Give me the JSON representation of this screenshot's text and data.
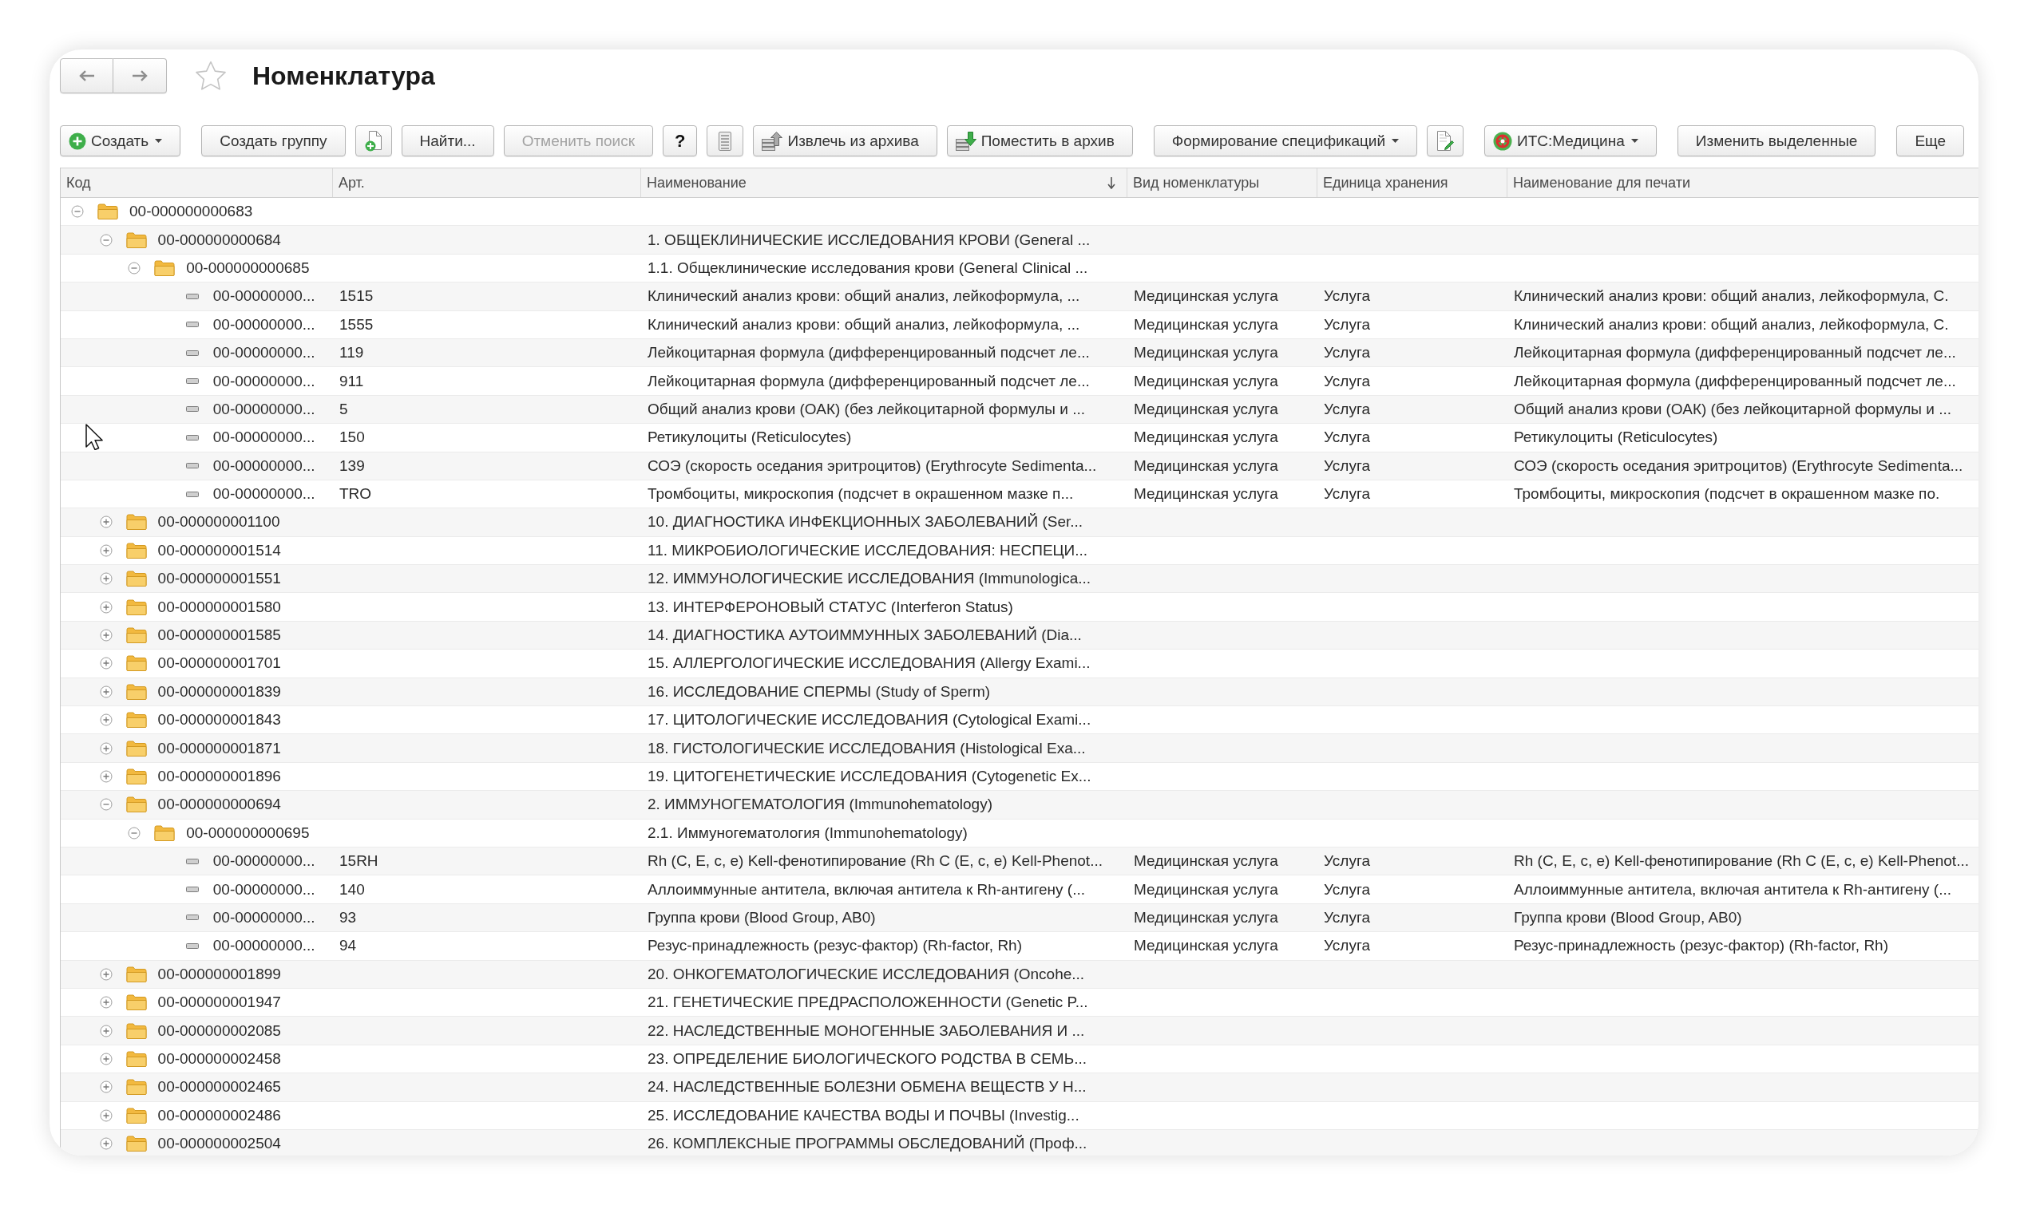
{
  "window": {
    "title": "Номенклатура"
  },
  "toolbar": {
    "groups": [
      {
        "buttons": [
          {
            "kind": "add",
            "label": "Создать",
            "dropdown": true,
            "disabled": false
          }
        ]
      },
      {
        "buttons": [
          {
            "kind": "plain",
            "label": "Создать группу",
            "dropdown": false,
            "disabled": false
          },
          {
            "kind": "addfile",
            "dropdown": false,
            "disabled": false
          },
          {
            "kind": "plain",
            "label": "Найти...",
            "dropdown": false,
            "disabled": false
          },
          {
            "kind": "plain",
            "label": "Отменить поиск",
            "dropdown": false,
            "disabled": true
          },
          {
            "kind": "help",
            "label": "?",
            "dropdown": false,
            "disabled": false
          },
          {
            "kind": "list",
            "dropdown": false,
            "disabled": false
          },
          {
            "kind": "unarchive",
            "label": "Извлечь из архива",
            "dropdown": false,
            "disabled": false
          },
          {
            "kind": "archive",
            "label": "Поместить в архив",
            "dropdown": false,
            "disabled": false
          }
        ]
      },
      {
        "buttons": [
          {
            "kind": "plain",
            "label": "Формирование спецификаций",
            "dropdown": true,
            "disabled": false
          },
          {
            "kind": "editdoc",
            "dropdown": false,
            "disabled": false
          }
        ]
      },
      {
        "buttons": [
          {
            "kind": "service",
            "label": "ИТС:Медицина",
            "dropdown": true,
            "disabled": false
          }
        ]
      },
      {
        "buttons": [
          {
            "kind": "plain",
            "label": "Изменить выделенные",
            "dropdown": false,
            "disabled": false
          }
        ]
      },
      {
        "buttons": [
          {
            "kind": "plain",
            "label": "Еще",
            "dropdown": false,
            "disabled": false
          }
        ]
      }
    ]
  },
  "table": {
    "columns": [
      {
        "label": "Код",
        "sorted": false
      },
      {
        "label": "Арт.",
        "sorted": false
      },
      {
        "label": "Наименование",
        "sorted": true
      },
      {
        "label": "Вид номенклатуры",
        "sorted": false
      },
      {
        "label": "Единица хранения",
        "sorted": false
      },
      {
        "label": "Наименование для печати",
        "sorted": false
      }
    ],
    "rows": [
      {
        "kind": "folder",
        "code": "00-000000000683",
        "expanded": true,
        "children": [
          {
            "kind": "folder",
            "code": "00-000000000684",
            "name": "1. ОБЩЕКЛИНИЧЕСКИЕ ИССЛЕДОВАНИЯ КРОВИ (General ...",
            "expanded": true,
            "children": [
              {
                "kind": "folder",
                "code": "00-000000000685",
                "name": "1.1. Общеклинические исследования крови (General Clinical ...",
                "expanded": true,
                "children": [
                  {
                    "kind": "item",
                    "code": "00-00000000...",
                    "article": "1515",
                    "name": "Клинический анализ крови: общий анализ, лейкоформула, ...",
                    "nomenclature_type": "Медицинская услуга",
                    "storage_unit": "Услуга",
                    "print_name": "Клинический анализ крови: общий анализ, лейкоформула, С."
                  },
                  {
                    "kind": "item",
                    "code": "00-00000000...",
                    "article": "1555",
                    "name": "Клинический анализ крови: общий анализ, лейкоформула, ...",
                    "nomenclature_type": "Медицинская услуга",
                    "storage_unit": "Услуга",
                    "print_name": "Клинический анализ крови: общий анализ, лейкоформула, С."
                  },
                  {
                    "kind": "item",
                    "code": "00-00000000...",
                    "article": "119",
                    "name": "Лейкоцитарная формула (дифференцированный подсчет ле...",
                    "nomenclature_type": "Медицинская услуга",
                    "storage_unit": "Услуга",
                    "print_name": "Лейкоцитарная формула (дифференцированный подсчет ле..."
                  },
                  {
                    "kind": "item",
                    "code": "00-00000000...",
                    "article": "911",
                    "name": "Лейкоцитарная формула (дифференцированный подсчет ле...",
                    "nomenclature_type": "Медицинская услуга",
                    "storage_unit": "Услуга",
                    "print_name": "Лейкоцитарная формула (дифференцированный подсчет ле..."
                  },
                  {
                    "kind": "item",
                    "code": "00-00000000...",
                    "article": "5",
                    "name": "Общий анализ крови (ОАК) (без лейкоцитарной формулы и ...",
                    "nomenclature_type": "Медицинская услуга",
                    "storage_unit": "Услуга",
                    "print_name": "Общий анализ крови (ОАК) (без лейкоцитарной формулы и ..."
                  },
                  {
                    "kind": "item",
                    "code": "00-00000000...",
                    "article": "150",
                    "name": "Ретикулоциты (Reticulocytes)",
                    "nomenclature_type": "Медицинская услуга",
                    "storage_unit": "Услуга",
                    "print_name": "Ретикулоциты (Reticulocytes)"
                  },
                  {
                    "kind": "item",
                    "code": "00-00000000...",
                    "article": "139",
                    "name": "СОЭ (скорость оседания эритроцитов) (Erythrocyte Sedimenta...",
                    "nomenclature_type": "Медицинская услуга",
                    "storage_unit": "Услуга",
                    "print_name": "СОЭ (скорость оседания эритроцитов) (Erythrocyte Sedimenta..."
                  },
                  {
                    "kind": "item",
                    "code": "00-00000000...",
                    "article": "TRO",
                    "name": "Тромбоциты, микроскопия (подсчет в окрашенном мазке п...",
                    "nomenclature_type": "Медицинская услуга",
                    "storage_unit": "Услуга",
                    "print_name": "Тромбоциты, микроскопия (подсчет в окрашенном мазке по."
                  }
                ]
              }
            ]
          },
          {
            "kind": "folder",
            "code": "00-000000001100",
            "name": "10. ДИАГНОСТИКА ИНФЕКЦИОННЫХ ЗАБОЛЕВАНИЙ (Ser...",
            "expanded": false
          },
          {
            "kind": "folder",
            "code": "00-000000001514",
            "name": "11. МИКРОБИОЛОГИЧЕСКИЕ ИССЛЕДОВАНИЯ: НЕСПЕЦИ...",
            "expanded": false
          },
          {
            "kind": "folder",
            "code": "00-000000001551",
            "name": "12. ИММУНОЛОГИЧЕСКИЕ ИССЛЕДОВАНИЯ (Immunologica...",
            "expanded": false
          },
          {
            "kind": "folder",
            "code": "00-000000001580",
            "name": "13. ИНТЕРФЕРОНОВЫЙ СТАТУС (Interferon Status)",
            "expanded": false
          },
          {
            "kind": "folder",
            "code": "00-000000001585",
            "name": "14. ДИАГНОСТИКА АУТОИММУННЫХ ЗАБОЛЕВАНИЙ (Dia...",
            "expanded": false
          },
          {
            "kind": "folder",
            "code": "00-000000001701",
            "name": "15. АЛЛЕРГОЛОГИЧЕСКИЕ ИССЛЕДОВАНИЯ (Allergy Exami...",
            "expanded": false
          },
          {
            "kind": "folder",
            "code": "00-000000001839",
            "name": "16. ИССЛЕДОВАНИЕ СПЕРМЫ (Study of Sperm)",
            "expanded": false
          },
          {
            "kind": "folder",
            "code": "00-000000001843",
            "name": "17. ЦИТОЛОГИЧЕСКИЕ ИССЛЕДОВАНИЯ (Cytological Exami...",
            "expanded": false
          },
          {
            "kind": "folder",
            "code": "00-000000001871",
            "name": "18. ГИСТОЛОГИЧЕСКИЕ ИССЛЕДОВАНИЯ (Histological Exa...",
            "expanded": false
          },
          {
            "kind": "folder",
            "code": "00-000000001896",
            "name": "19. ЦИТОГЕНЕТИЧЕСКИЕ ИССЛЕДОВАНИЯ (Cytogenetic Ex...",
            "expanded": false
          },
          {
            "kind": "folder",
            "code": "00-000000000694",
            "name": "2. ИММУНОГЕМАТОЛОГИЯ (Immunohematology)",
            "expanded": true,
            "children": [
              {
                "kind": "folder",
                "code": "00-000000000695",
                "name": "2.1. Иммуногематология (Immunohematology)",
                "expanded": true,
                "children": [
                  {
                    "kind": "item",
                    "code": "00-00000000...",
                    "article": "15RH",
                    "name": "Rh (C, E, c, e) Kell-фенотипирование (Rh C (E, c, e) Kell-Phenot...",
                    "nomenclature_type": "Медицинская услуга",
                    "storage_unit": "Услуга",
                    "print_name": "Rh (C, E, c, e) Kell-фенотипирование (Rh C (E, c, e) Kell-Phenot..."
                  },
                  {
                    "kind": "item",
                    "code": "00-00000000...",
                    "article": "140",
                    "name": "Аллоиммунные антитела, включая антитела к Rh-антигену (...",
                    "nomenclature_type": "Медицинская услуга",
                    "storage_unit": "Услуга",
                    "print_name": "Аллоиммунные антитела, включая антитела к Rh-антигену (..."
                  },
                  {
                    "kind": "item",
                    "code": "00-00000000...",
                    "article": "93",
                    "name": "Группа крови (Blood Group, AB0)",
                    "nomenclature_type": "Медицинская услуга",
                    "storage_unit": "Услуга",
                    "print_name": "Группа крови (Blood Group, AB0)"
                  },
                  {
                    "kind": "item",
                    "code": "00-00000000...",
                    "article": "94",
                    "name": "Резус-принадлежность (резус-фактор) (Rh-factor, Rh)",
                    "nomenclature_type": "Медицинская услуга",
                    "storage_unit": "Услуга",
                    "print_name": "Резус-принадлежность (резус-фактор) (Rh-factor, Rh)"
                  }
                ]
              }
            ]
          },
          {
            "kind": "folder",
            "code": "00-000000001899",
            "name": "20. ОНКОГЕМАТОЛОГИЧЕСКИЕ ИССЛЕДОВАНИЯ (Oncohe...",
            "expanded": false
          },
          {
            "kind": "folder",
            "code": "00-000000001947",
            "name": "21. ГЕНЕТИЧЕСКИЕ ПРЕДРАСПОЛОЖЕННОСТИ (Genetic P...",
            "expanded": false
          },
          {
            "kind": "folder",
            "code": "00-000000002085",
            "name": "22. НАСЛЕДСТВЕННЫЕ МОНОГЕННЫЕ ЗАБОЛЕВАНИЯ И ...",
            "expanded": false
          },
          {
            "kind": "folder",
            "code": "00-000000002458",
            "name": "23. ОПРЕДЕЛЕНИЕ БИОЛОГИЧЕСКОГО РОДСТВА В СЕМЬ...",
            "expanded": false
          },
          {
            "kind": "folder",
            "code": "00-000000002465",
            "name": "24. НАСЛЕДСТВЕННЫЕ БОЛЕЗНИ ОБМЕНА ВЕЩЕСТВ У Н...",
            "expanded": false
          },
          {
            "kind": "folder",
            "code": "00-000000002486",
            "name": "25. ИССЛЕДОВАНИЕ КАЧЕСТВА ВОДЫ И ПОЧВЫ (Investig...",
            "expanded": false
          },
          {
            "kind": "folder",
            "code": "00-000000002504",
            "name": "26. КОМПЛЕКСНЫЕ ПРОГРАММЫ ОБСЛЕДОВАНИЙ (Проф...",
            "expanded": false
          }
        ]
      }
    ]
  }
}
